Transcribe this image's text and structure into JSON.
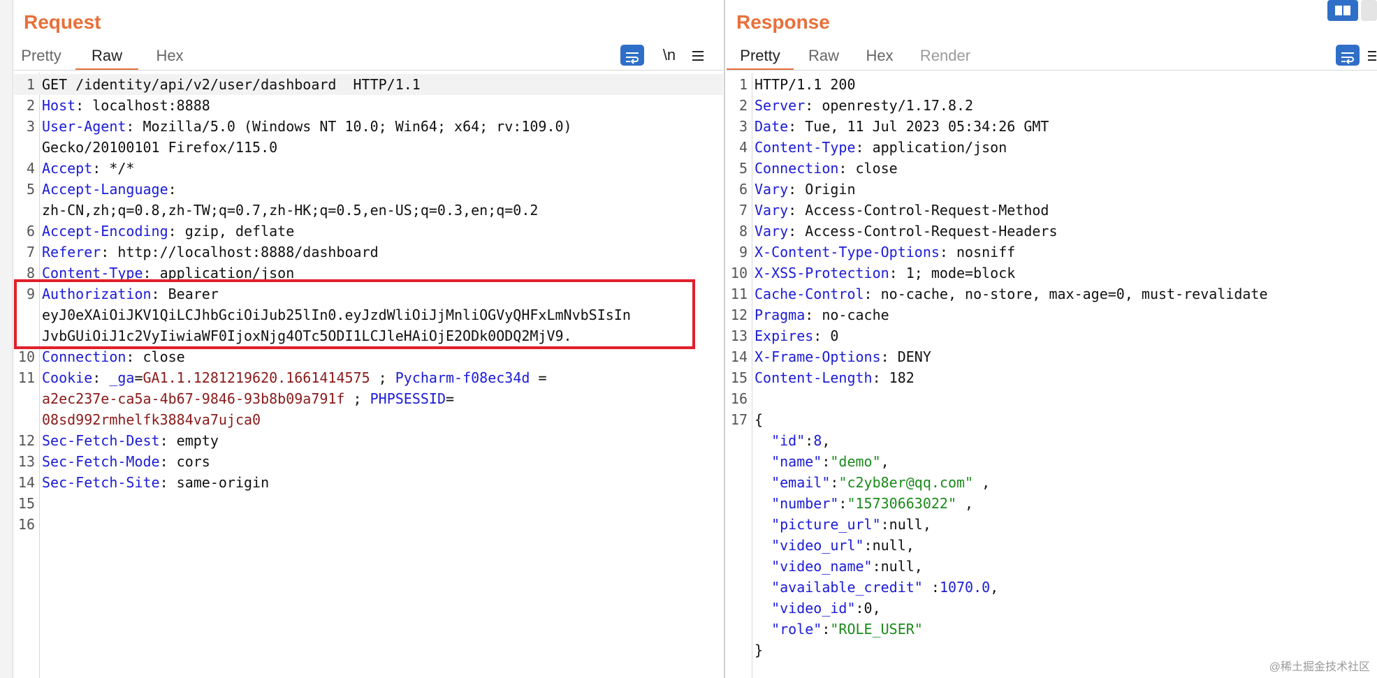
{
  "request": {
    "title": "Request",
    "tabs": [
      "Pretty",
      "Raw",
      "Hex"
    ],
    "active_tab": "Raw",
    "newline_toggle": "\\n",
    "lines": [
      {
        "n": "1",
        "segs": [
          {
            "t": "GET /identity/api/v2/user/dashboard  HTTP/1.1",
            "c": ""
          }
        ]
      },
      {
        "n": "2",
        "segs": [
          {
            "t": "Host",
            "c": "hn"
          },
          {
            "t": ": localhost:8888",
            "c": ""
          }
        ]
      },
      {
        "n": "3",
        "segs": [
          {
            "t": "User-Agent",
            "c": "hn"
          },
          {
            "t": ": Mozilla/5.0 (Windows NT 10.0; Win64; x64; rv:109.0)",
            "c": ""
          }
        ]
      },
      {
        "n": "",
        "segs": [
          {
            "t": "Gecko/20100101 Firefox/115.0",
            "c": ""
          }
        ]
      },
      {
        "n": "4",
        "segs": [
          {
            "t": "Accept",
            "c": "hn"
          },
          {
            "t": ": */*",
            "c": ""
          }
        ]
      },
      {
        "n": "5",
        "segs": [
          {
            "t": "Accept-Language",
            "c": "hn"
          },
          {
            "t": ":",
            "c": ""
          }
        ]
      },
      {
        "n": "",
        "segs": [
          {
            "t": "zh-CN,zh;q=0.8,zh-TW;q=0.7,zh-HK;q=0.5,en-US;q=0.3,en;q=0.2",
            "c": ""
          }
        ]
      },
      {
        "n": "6",
        "segs": [
          {
            "t": "Accept-Encoding",
            "c": "hn"
          },
          {
            "t": ": gzip, deflate",
            "c": ""
          }
        ]
      },
      {
        "n": "7",
        "segs": [
          {
            "t": "Referer",
            "c": "hn"
          },
          {
            "t": ": http://localhost:8888/dashboard",
            "c": ""
          }
        ]
      },
      {
        "n": "8",
        "segs": [
          {
            "t": "Content-Type",
            "c": "hn"
          },
          {
            "t": ": application/json",
            "c": ""
          }
        ]
      },
      {
        "n": "9",
        "segs": [
          {
            "t": "Authorization",
            "c": "hn"
          },
          {
            "t": ": Bearer",
            "c": ""
          }
        ]
      },
      {
        "n": "",
        "segs": [
          {
            "t": "eyJ0eXAiOiJKV1QiLCJhbGciOiJub25lIn0.eyJzdWliOiJjMnliOGVyQHFxLmNvbSIsIn",
            "c": ""
          }
        ]
      },
      {
        "n": "",
        "segs": [
          {
            "t": "JvbGUiOiJ1c2VyIiwiaWF0IjoxNjg4OTc5ODI1LCJleHAiOjE2ODk0ODQ2MjV9.",
            "c": ""
          }
        ]
      },
      {
        "n": "10",
        "segs": [
          {
            "t": "Connection",
            "c": "hn"
          },
          {
            "t": ": close",
            "c": ""
          }
        ]
      },
      {
        "n": "11",
        "segs": [
          {
            "t": "Cookie",
            "c": "hn"
          },
          {
            "t": ": ",
            "c": ""
          },
          {
            "t": "_ga",
            "c": "hn"
          },
          {
            "t": "=",
            "c": ""
          },
          {
            "t": "GA1.1.1281219620.1661414575",
            "c": "sv"
          },
          {
            "t": " ; ",
            "c": ""
          },
          {
            "t": "Pycharm-f08ec34d",
            "c": "hn"
          },
          {
            "t": " =",
            "c": ""
          }
        ]
      },
      {
        "n": "",
        "segs": [
          {
            "t": "a2ec237e-ca5a-4b67-9846-93b8b09a791f",
            "c": "sv"
          },
          {
            "t": " ; ",
            "c": ""
          },
          {
            "t": "PHPSESSID",
            "c": "hn"
          },
          {
            "t": "=",
            "c": ""
          }
        ]
      },
      {
        "n": "",
        "segs": [
          {
            "t": "08sd992rmhelfk3884va7ujca0",
            "c": "sv"
          }
        ]
      },
      {
        "n": "12",
        "segs": [
          {
            "t": "Sec-Fetch-Dest",
            "c": "hn"
          },
          {
            "t": ": empty",
            "c": ""
          }
        ]
      },
      {
        "n": "13",
        "segs": [
          {
            "t": "Sec-Fetch-Mode",
            "c": "hn"
          },
          {
            "t": ": cors",
            "c": ""
          }
        ]
      },
      {
        "n": "14",
        "segs": [
          {
            "t": "Sec-Fetch-Site",
            "c": "hn"
          },
          {
            "t": ": same-origin",
            "c": ""
          }
        ]
      },
      {
        "n": "15",
        "segs": [
          {
            "t": "",
            "c": ""
          }
        ]
      },
      {
        "n": "16",
        "segs": [
          {
            "t": "",
            "c": ""
          }
        ]
      }
    ]
  },
  "response": {
    "title": "Response",
    "tabs": [
      "Pretty",
      "Raw",
      "Hex",
      "Render"
    ],
    "active_tab": "Pretty",
    "disabled_tab": "Render",
    "lines": [
      {
        "n": "1",
        "segs": [
          {
            "t": "HTTP/1.1 200",
            "c": ""
          }
        ]
      },
      {
        "n": "2",
        "segs": [
          {
            "t": "Server",
            "c": "hn"
          },
          {
            "t": ": openresty/1.17.8.2",
            "c": ""
          }
        ]
      },
      {
        "n": "3",
        "segs": [
          {
            "t": "Date",
            "c": "hn"
          },
          {
            "t": ": Tue, 11 Jul 2023 05:34:26 GMT",
            "c": ""
          }
        ]
      },
      {
        "n": "4",
        "segs": [
          {
            "t": "Content-Type",
            "c": "hn"
          },
          {
            "t": ": application/json",
            "c": ""
          }
        ]
      },
      {
        "n": "5",
        "segs": [
          {
            "t": "Connection",
            "c": "hn"
          },
          {
            "t": ": close",
            "c": ""
          }
        ]
      },
      {
        "n": "6",
        "segs": [
          {
            "t": "Vary",
            "c": "hn"
          },
          {
            "t": ": Origin",
            "c": ""
          }
        ]
      },
      {
        "n": "7",
        "segs": [
          {
            "t": "Vary",
            "c": "hn"
          },
          {
            "t": ": Access-Control-Request-Method",
            "c": ""
          }
        ]
      },
      {
        "n": "8",
        "segs": [
          {
            "t": "Vary",
            "c": "hn"
          },
          {
            "t": ": Access-Control-Request-Headers",
            "c": ""
          }
        ]
      },
      {
        "n": "9",
        "segs": [
          {
            "t": "X-Content-Type-Options",
            "c": "hn"
          },
          {
            "t": ": nosniff",
            "c": ""
          }
        ]
      },
      {
        "n": "10",
        "segs": [
          {
            "t": "X-XSS-Protection",
            "c": "hn"
          },
          {
            "t": ": 1; mode=block",
            "c": ""
          }
        ]
      },
      {
        "n": "11",
        "segs": [
          {
            "t": "Cache-Control",
            "c": "hn"
          },
          {
            "t": ": no-cache, no-store, max-age=0, must-revalidate",
            "c": ""
          }
        ]
      },
      {
        "n": "12",
        "segs": [
          {
            "t": "Pragma",
            "c": "hn"
          },
          {
            "t": ": no-cache",
            "c": ""
          }
        ]
      },
      {
        "n": "13",
        "segs": [
          {
            "t": "Expires",
            "c": "hn"
          },
          {
            "t": ": 0",
            "c": ""
          }
        ]
      },
      {
        "n": "14",
        "segs": [
          {
            "t": "X-Frame-Options",
            "c": "hn"
          },
          {
            "t": ": DENY",
            "c": ""
          }
        ]
      },
      {
        "n": "15",
        "segs": [
          {
            "t": "Content-Length",
            "c": "hn"
          },
          {
            "t": ": 182",
            "c": ""
          }
        ]
      },
      {
        "n": "16",
        "segs": [
          {
            "t": "",
            "c": ""
          }
        ]
      },
      {
        "n": "17",
        "segs": [
          {
            "t": "{",
            "c": ""
          }
        ]
      },
      {
        "n": "",
        "segs": [
          {
            "t": "  ",
            "c": ""
          },
          {
            "t": "\"id\"",
            "c": "jk"
          },
          {
            "t": ":",
            "c": ""
          },
          {
            "t": "8",
            "c": "jn"
          },
          {
            "t": ",",
            "c": ""
          }
        ]
      },
      {
        "n": "",
        "segs": [
          {
            "t": "  ",
            "c": ""
          },
          {
            "t": "\"name\"",
            "c": "jk"
          },
          {
            "t": ":",
            "c": ""
          },
          {
            "t": "\"demo\"",
            "c": "js"
          },
          {
            "t": ",",
            "c": ""
          }
        ]
      },
      {
        "n": "",
        "segs": [
          {
            "t": "  ",
            "c": ""
          },
          {
            "t": "\"email\"",
            "c": "jk"
          },
          {
            "t": ":",
            "c": ""
          },
          {
            "t": "\"c2yb8er@qq.com\"",
            "c": "js"
          },
          {
            "t": " ,",
            "c": ""
          }
        ]
      },
      {
        "n": "",
        "segs": [
          {
            "t": "  ",
            "c": ""
          },
          {
            "t": "\"number\"",
            "c": "jk"
          },
          {
            "t": ":",
            "c": ""
          },
          {
            "t": "\"15730663022\"",
            "c": "js"
          },
          {
            "t": " ,",
            "c": ""
          }
        ]
      },
      {
        "n": "",
        "segs": [
          {
            "t": "  ",
            "c": ""
          },
          {
            "t": "\"picture_url\"",
            "c": "jk"
          },
          {
            "t": ":null,",
            "c": ""
          }
        ]
      },
      {
        "n": "",
        "segs": [
          {
            "t": "  ",
            "c": ""
          },
          {
            "t": "\"video_url\"",
            "c": "jk"
          },
          {
            "t": ":null,",
            "c": ""
          }
        ]
      },
      {
        "n": "",
        "segs": [
          {
            "t": "  ",
            "c": ""
          },
          {
            "t": "\"video_name\"",
            "c": "jk"
          },
          {
            "t": ":null,",
            "c": ""
          }
        ]
      },
      {
        "n": "",
        "segs": [
          {
            "t": "  ",
            "c": ""
          },
          {
            "t": "\"available_credit\"",
            "c": "jk"
          },
          {
            "t": " :",
            "c": ""
          },
          {
            "t": "1070.0",
            "c": "jn"
          },
          {
            "t": ",",
            "c": ""
          }
        ]
      },
      {
        "n": "",
        "segs": [
          {
            "t": "  ",
            "c": ""
          },
          {
            "t": "\"video_id\"",
            "c": "jk"
          },
          {
            "t": ":0,",
            "c": ""
          }
        ]
      },
      {
        "n": "",
        "segs": [
          {
            "t": "  ",
            "c": ""
          },
          {
            "t": "\"role\"",
            "c": "jk"
          },
          {
            "t": ":",
            "c": ""
          },
          {
            "t": "\"ROLE_USER\"",
            "c": "js"
          }
        ]
      },
      {
        "n": "",
        "segs": [
          {
            "t": "}",
            "c": ""
          }
        ]
      }
    ]
  },
  "watermark": "@稀土掘金技术社区",
  "colors": {
    "accent": "#e8703a",
    "highlight_box": "#e0202a",
    "button_blue": "#2f6fc7"
  },
  "icons": [
    "text-wrap-icon",
    "menu-icon",
    "layout-split-icon"
  ]
}
